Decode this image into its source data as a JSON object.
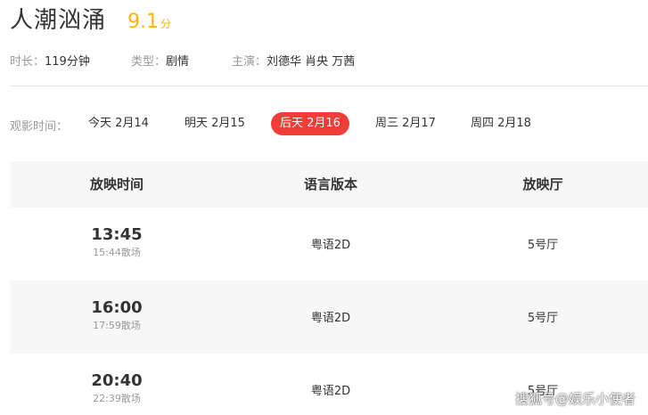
{
  "movie": {
    "title": "人潮汹涌",
    "score": "9.1",
    "score_unit": "分"
  },
  "meta": {
    "duration_label": "时长：",
    "duration_value": "119分钟",
    "genre_label": "类型：",
    "genre_value": "剧情",
    "cast_label": "主演：",
    "cast_value": "刘德华 肖央 万茜"
  },
  "dates": {
    "label": "观影时间：",
    "tabs": [
      {
        "label": "今天 2月14",
        "active": false
      },
      {
        "label": "明天 2月15",
        "active": false
      },
      {
        "label": "后天 2月16",
        "active": true
      },
      {
        "label": "周三 2月17",
        "active": false
      },
      {
        "label": "周四 2月18",
        "active": false
      }
    ]
  },
  "table": {
    "headers": [
      "放映时间",
      "语言版本",
      "放映厅"
    ],
    "rows": [
      {
        "start": "13:45",
        "end": "15:44散场",
        "language": "粤语2D",
        "hall": "5号厅"
      },
      {
        "start": "16:00",
        "end": "17:59散场",
        "language": "粤语2D",
        "hall": "5号厅"
      },
      {
        "start": "20:40",
        "end": "22:39散场",
        "language": "粤语2D",
        "hall": "5号厅"
      }
    ]
  },
  "watermark": "搜狐号@娱乐小使者",
  "colors": {
    "accent_red": "#f03d37",
    "score_orange": "#ffb400",
    "alt_row_bg": "#f7f7f7"
  }
}
